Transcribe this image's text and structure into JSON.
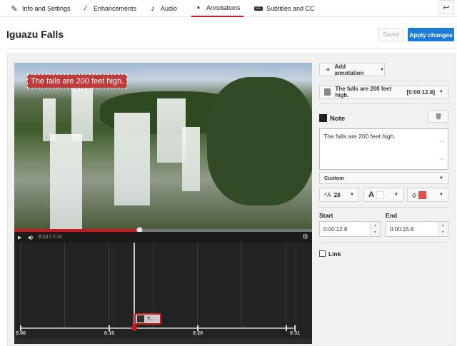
{
  "nav": {
    "tabs": [
      {
        "label": "Info and Settings",
        "icon": "pencil-icon"
      },
      {
        "label": "Enhancements",
        "icon": "magic-wand-icon"
      },
      {
        "label": "Audio",
        "icon": "music-note-icon"
      },
      {
        "label": "Annotations",
        "icon": "speech-bubble-icon",
        "active": true
      },
      {
        "label": "Subtitles and CC",
        "icon": "cc-icon"
      }
    ],
    "back_icon": "↩"
  },
  "header": {
    "title": "Iguazu Falls",
    "saved_label": "Saved",
    "apply_label": "Apply changes"
  },
  "video": {
    "overlay_text": "The falls are 200 feet high.",
    "current_time": "0:12",
    "duration": "0:30",
    "progress": 0.42
  },
  "timeline": {
    "ticks": [
      "0:00",
      "0:10",
      "0:20",
      "0:31"
    ],
    "chip_label": "T..."
  },
  "panel": {
    "add_annotation": "Add annotation",
    "selected_annotation": {
      "text": "The falls are 200 feet high.",
      "time": "[0:00:12.8]"
    },
    "note_label": "Note",
    "note_text": "The falls are 200 feet high.",
    "style_select": "Custom",
    "font_size": "28",
    "bg_color": "#d9534f",
    "text_color": "#ffffff",
    "start_label": "Start",
    "start_value": "0:00:12.8",
    "end_label": "End",
    "end_value": "0:00:15.8",
    "link_label": "Link"
  }
}
